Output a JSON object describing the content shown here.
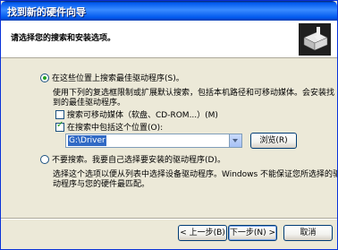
{
  "window": {
    "title": "找到新的硬件向导"
  },
  "header": {
    "heading": "请选择您的搜索和安装选项。"
  },
  "options": {
    "search_best": {
      "label": "在这些位置上搜索最佳驱动程序(S)。",
      "desc_line1": "使用下列的复选框限制或扩展默认搜索，包括本机路径和可移动媒体。会安装找",
      "desc_line2": "到的最佳驱动程序。",
      "selected": true
    },
    "removable_media": {
      "label": "搜索可移动媒体（软盘、CD-ROM...）(M)",
      "checked": false
    },
    "include_location": {
      "label": "在搜索中包括这个位置(O):",
      "checked": true
    },
    "path": {
      "value": "G:\\Driver"
    },
    "browse_button": "浏览(R)",
    "no_search": {
      "label": "不要搜索。我要自己选择要安装的驱动程序(D)。",
      "desc_line1": "选择这个选项以便从列表中选择设备驱动程序。Windows 不能保证您所选择的驱",
      "desc_line2": "动程序与您的硬件最匹配。",
      "selected": false
    }
  },
  "footer": {
    "back_label": "< 上一步(B)",
    "next_label": "下一步(N) >",
    "cancel_label": "取消"
  }
}
